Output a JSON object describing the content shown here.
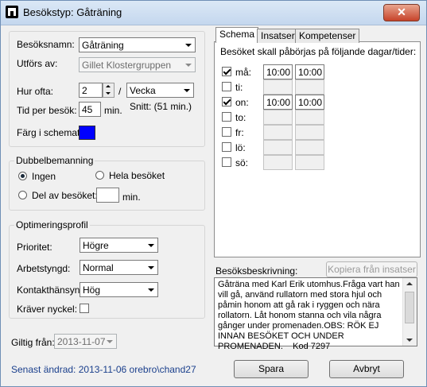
{
  "window": {
    "title": "Besökstyp: Gåträning"
  },
  "visit": {
    "name_label": "Besöksnamn:",
    "name_value": "Gåträning",
    "performed_by_label": "Utförs av:",
    "performed_by_value": "Gillet Klostergruppen",
    "frequency_label": "Hur ofta:",
    "frequency_value": "2",
    "frequency_sep": "/",
    "frequency_unit": "Vecka",
    "time_label": "Tid per besök:",
    "time_value": "45",
    "time_unit": "min.",
    "average": "Snitt: (51 min.)",
    "color_label": "Färg i schemat:",
    "color": "#0000ff"
  },
  "double_staffing": {
    "legend": "Dubbelbemanning",
    "none_label": "Ingen",
    "whole_label": "Hela besöket",
    "part_label": "Del av besöket:",
    "part_value": "",
    "part_unit": "min."
  },
  "optimization": {
    "legend": "Optimeringsprofil",
    "priority_label": "Prioritet:",
    "priority_value": "Högre",
    "workload_label": "Arbetstyngd:",
    "workload_value": "Normal",
    "contact_label": "Kontakthänsyn:",
    "contact_value": "Hög",
    "key_label": "Kräver nyckel:"
  },
  "valid_from": {
    "label": "Giltig från:",
    "value": "2013-11-07"
  },
  "status": {
    "last_changed": "Senast ändrad: 2013-11-06 orebro\\chand27"
  },
  "tabs": [
    {
      "label": "Schema"
    },
    {
      "label": "Insatser"
    },
    {
      "label": "Kompetenser"
    }
  ],
  "schedule": {
    "heading": "Besöket skall påbörjas på följande dagar/tider:",
    "days": [
      {
        "label": "må:",
        "checked": true,
        "from": "10:00",
        "to": "10:00"
      },
      {
        "label": "ti:",
        "checked": false,
        "from": "",
        "to": ""
      },
      {
        "label": "on:",
        "checked": true,
        "from": "10:00",
        "to": "10:00"
      },
      {
        "label": "to:",
        "checked": false,
        "from": "",
        "to": ""
      },
      {
        "label": "fr:",
        "checked": false,
        "from": "",
        "to": ""
      },
      {
        "label": "lö:",
        "checked": false,
        "from": "",
        "to": ""
      },
      {
        "label": "sö:",
        "checked": false,
        "from": "",
        "to": ""
      }
    ]
  },
  "description": {
    "label": "Besöksbeskrivning:",
    "copy_button": "Kopiera från insatser",
    "text": "Gåträna med Karl Erik utomhus.Fråga vart han vill gå, använd rullatorn med stora hjul och påmin honom att gå rak i ryggen och nära rollatorn. Låt honom stanna och vila några gånger under promenaden.OBS: RÖK EJ INNAN BESÖKET OCH UNDER PROMENADEN.    Kod 7297"
  },
  "buttons": {
    "save": "Spara",
    "cancel": "Avbryt"
  }
}
